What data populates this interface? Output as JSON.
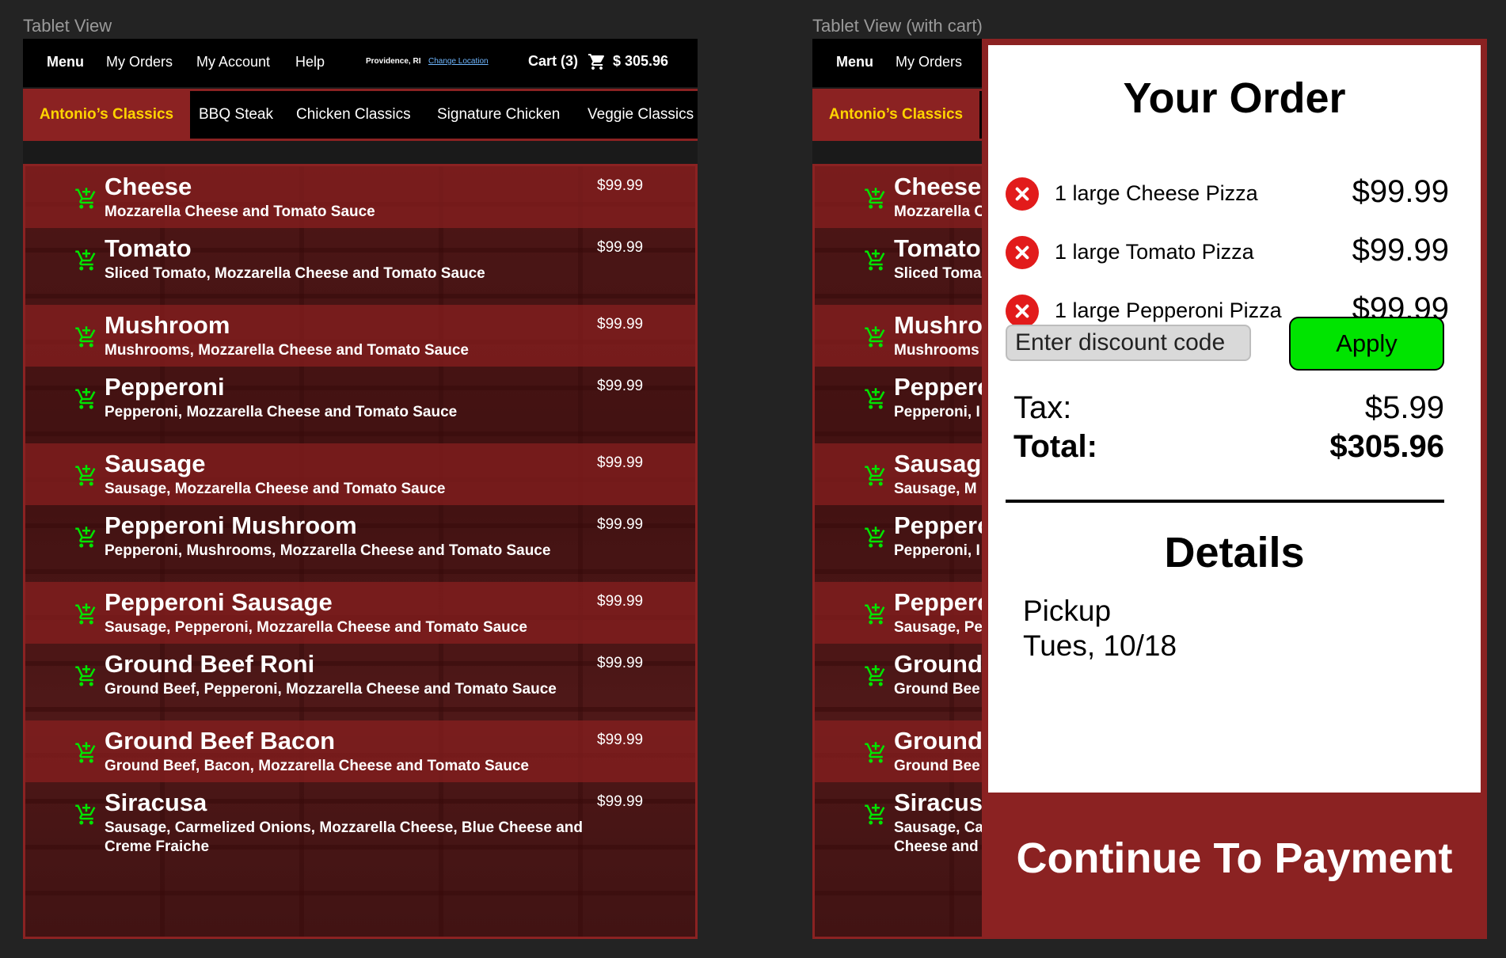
{
  "frames": {
    "left_label": "Tablet View",
    "right_label": "Tablet View (with cart)"
  },
  "nav": {
    "menu": "Menu",
    "orders": "My Orders",
    "account": "My Account",
    "help": "Help",
    "location": "Providence, RI",
    "change_location": "Change Location",
    "cart_label": "Cart (3)",
    "cart_total": "$ 305.96",
    "cart_icon": "cart-icon"
  },
  "categories": {
    "active": "Antonio’s Classics",
    "items": [
      "BBQ Steak",
      "Chicken Classics",
      "Signature Chicken",
      "Veggie Classics"
    ]
  },
  "menu_items": [
    {
      "name": "Cheese",
      "desc": "Mozzarella Cheese and Tomato Sauce",
      "price": "$99.99"
    },
    {
      "name": "Tomato",
      "desc": "Sliced Tomato, Mozzarella Cheese and Tomato Sauce",
      "price": "$99.99"
    },
    {
      "name": "Mushroom",
      "desc": "Mushrooms, Mozzarella Cheese and Tomato Sauce",
      "price": "$99.99"
    },
    {
      "name": "Pepperoni",
      "desc": "Pepperoni, Mozzarella Cheese and Tomato Sauce",
      "price": "$99.99"
    },
    {
      "name": "Sausage",
      "desc": "Sausage, Mozzarella Cheese and Tomato Sauce",
      "price": "$99.99"
    },
    {
      "name": "Pepperoni Mushroom",
      "desc": "Pepperoni, Mushrooms, Mozzarella Cheese and Tomato Sauce",
      "price": "$99.99"
    },
    {
      "name": "Pepperoni Sausage",
      "desc": "Sausage, Pepperoni, Mozzarella Cheese and Tomato Sauce",
      "price": "$99.99"
    },
    {
      "name": "Ground Beef Roni",
      "desc": "Ground Beef, Pepperoni, Mozzarella Cheese and Tomato Sauce",
      "price": "$99.99"
    },
    {
      "name": "Ground Beef Bacon",
      "desc": "Ground Beef, Bacon, Mozzarella Cheese and Tomato Sauce",
      "price": "$99.99"
    },
    {
      "name": "Siracusa",
      "desc": "Sausage, Carmelized Onions, Mozzarella Cheese, Blue Cheese and Creme Fraiche",
      "price": "$99.99"
    }
  ],
  "right_visible_items": [
    {
      "name": "Cheese",
      "desc": "Mozzarella C"
    },
    {
      "name": "Tomato",
      "desc": "Sliced Toma"
    },
    {
      "name": "Mushroo",
      "desc": "Mushrooms"
    },
    {
      "name": "Pepperc",
      "desc": "Pepperoni, I"
    },
    {
      "name": "Sausage",
      "desc": "Sausage, M"
    },
    {
      "name": "Pepperc",
      "desc": "Pepperoni, I"
    },
    {
      "name": "Pepperc",
      "desc": "Sausage, Pe"
    },
    {
      "name": "Ground",
      "desc": "Ground Bee"
    },
    {
      "name": "Ground",
      "desc": "Ground Bee"
    },
    {
      "name": "Siracus",
      "desc": "Sausage, Ca"
    }
  ],
  "right_siracusa_line2": "Cheese and",
  "cart": {
    "title": "Your Order",
    "items": [
      {
        "label": "1 large Cheese Pizza",
        "price": "$99.99"
      },
      {
        "label": "1 large Tomato Pizza",
        "price": "$99.99"
      },
      {
        "label": "1 large Pepperoni Pizza",
        "price": "$99.99"
      }
    ],
    "discount_placeholder": "Enter discount code",
    "apply": "Apply",
    "tax_label": "Tax:",
    "tax": "$5.99",
    "total_label": "Total:",
    "total": "$305.96",
    "details_title": "Details",
    "details": [
      "Pickup",
      "Tues, 10/18"
    ],
    "continue": "Continue To Payment"
  },
  "colors": {
    "accent_red": "#8b2222",
    "active_category": "#ffd400",
    "cart_icon_green": "#00e400",
    "remove_red": "#e21b1b",
    "apply_green": "#00e400"
  }
}
